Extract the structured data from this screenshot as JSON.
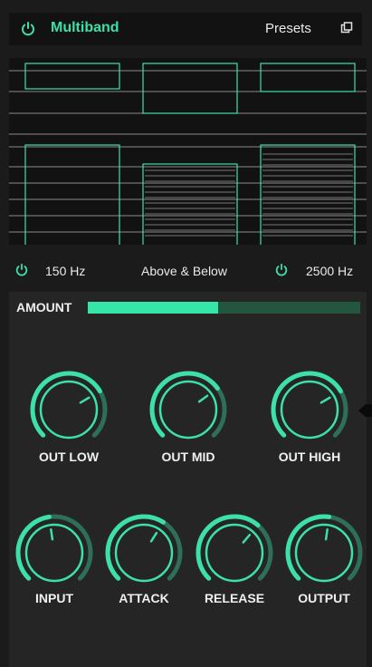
{
  "header": {
    "title": "Multiband",
    "presets_label": "Presets"
  },
  "icons": {
    "power": "power-icon",
    "copy": "copy-icon"
  },
  "crossover": {
    "low_freq": "150 Hz",
    "mode": "Above & Below",
    "high_freq": "2500 Hz"
  },
  "amount": {
    "label": "AMOUNT",
    "value": 0.48
  },
  "knobs_row1": [
    {
      "label": "OUT LOW",
      "value": 0.72
    },
    {
      "label": "OUT MID",
      "value": 0.7
    },
    {
      "label": "OUT HIGH",
      "value": 0.72
    }
  ],
  "knobs_row2": [
    {
      "label": "INPUT",
      "value": 0.47
    },
    {
      "label": "ATTACK",
      "value": 0.62
    },
    {
      "label": "RELEASE",
      "value": 0.65
    },
    {
      "label": "OUTPUT",
      "value": 0.53
    }
  ],
  "colors": {
    "accent": "#3de0a8",
    "accent_dim": "#2e6f57",
    "track": "#3a3a3a",
    "panel": "#252525",
    "background": "#1b1b1b",
    "graph_bg": "#121212",
    "grid": "#8a8a8a"
  }
}
